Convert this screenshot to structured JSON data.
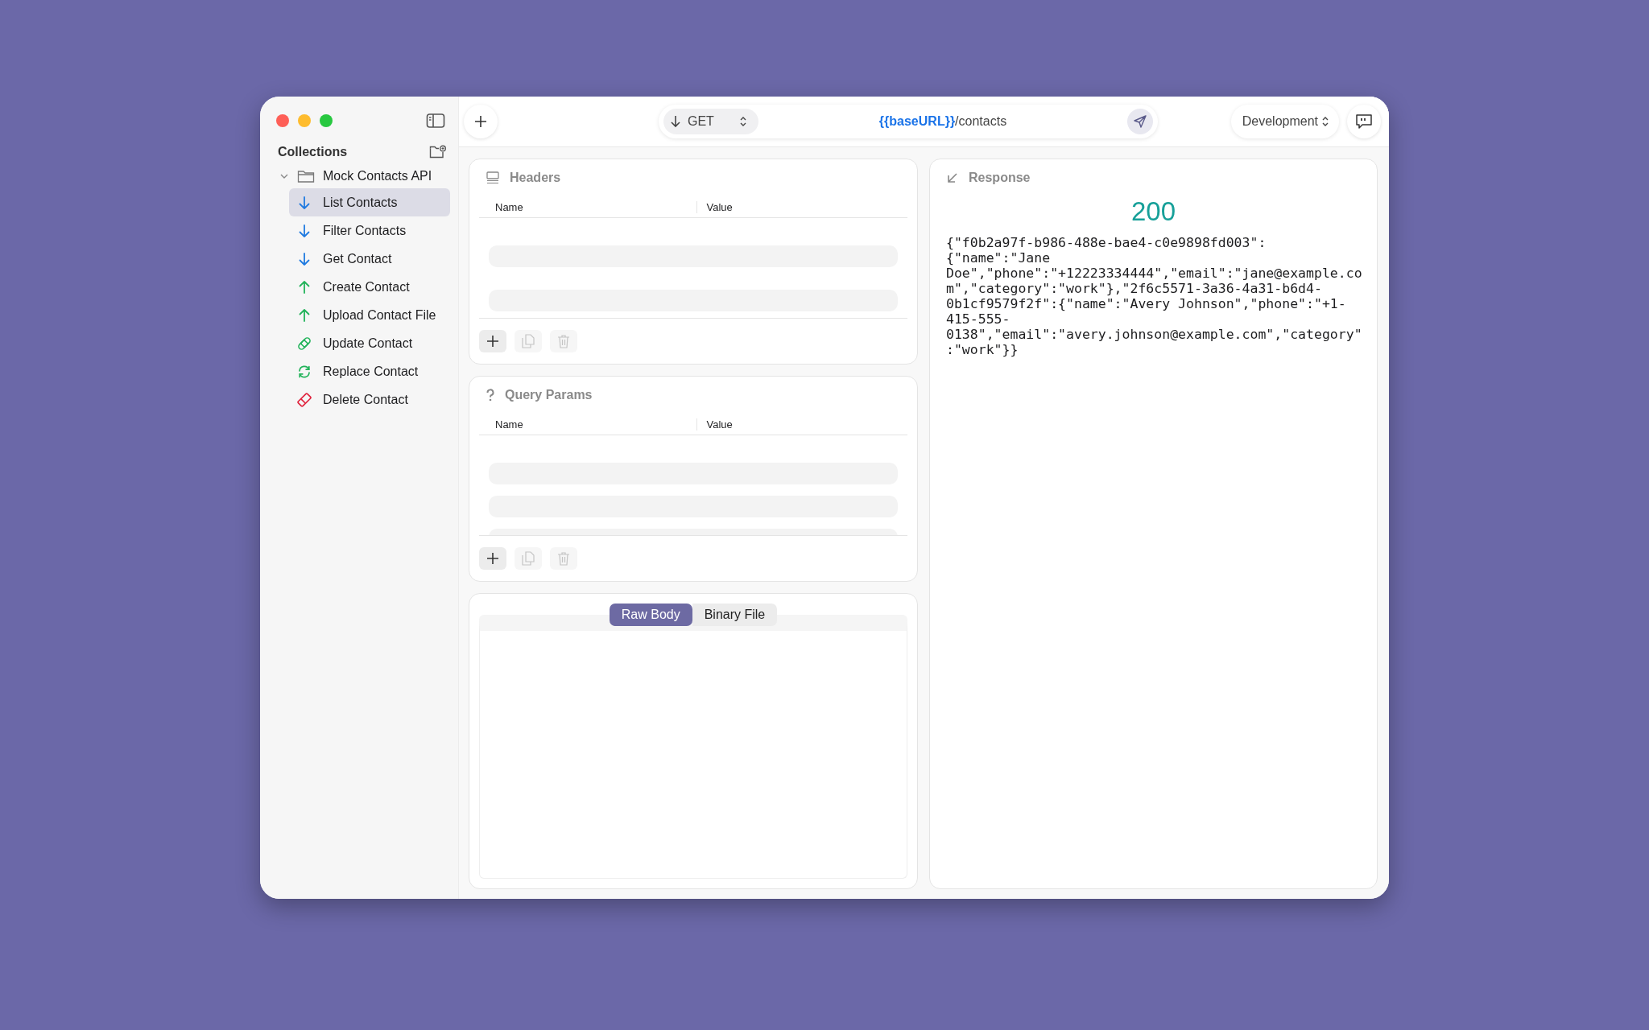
{
  "sidebar": {
    "title": "Collections",
    "collection": {
      "name": "Mock Contacts API",
      "expanded": true,
      "items": [
        {
          "label": "List Contacts",
          "kind": "get",
          "selected": true
        },
        {
          "label": "Filter Contacts",
          "kind": "get",
          "selected": false
        },
        {
          "label": "Get Contact",
          "kind": "get",
          "selected": false
        },
        {
          "label": "Create Contact",
          "kind": "post",
          "selected": false
        },
        {
          "label": "Upload Contact File",
          "kind": "post",
          "selected": false
        },
        {
          "label": "Update Contact",
          "kind": "patch",
          "selected": false
        },
        {
          "label": "Replace Contact",
          "kind": "put",
          "selected": false
        },
        {
          "label": "Delete Contact",
          "kind": "delete",
          "selected": false
        }
      ]
    }
  },
  "toolbar": {
    "method": "GET",
    "url": {
      "variable": "{{baseURL}}",
      "path": "/contacts"
    },
    "environment": "Development"
  },
  "panels": [
    {
      "kind": "headers",
      "title": "Headers",
      "columns": [
        "Name",
        "Value"
      ],
      "buttons": [
        {
          "kind": "add",
          "disabled": false
        },
        {
          "kind": "copy",
          "disabled": true
        },
        {
          "kind": "delete",
          "disabled": true
        }
      ]
    },
    {
      "kind": "query",
      "title": "Query Params",
      "columns": [
        "Name",
        "Value"
      ],
      "buttons": [
        {
          "kind": "add",
          "disabled": false
        },
        {
          "kind": "copy",
          "disabled": true
        },
        {
          "kind": "delete",
          "disabled": true
        }
      ]
    }
  ],
  "body": {
    "tabs": [
      {
        "label": "Raw Body",
        "selected": true
      },
      {
        "label": "Binary File",
        "selected": false
      }
    ]
  },
  "response": {
    "title": "Response",
    "status": "200",
    "body": "{\"f0b2a97f-b986-488e-bae4-c0e9898fd003\":{\"name\":\"Jane Doe\",\"phone\":\"+12223334444\",\"email\":\"jane@example.com\",\"category\":\"work\"},\"2f6c5571-3a36-4a31-b6d4-0b1cf9579f2f\":{\"name\":\"Avery Johnson\",\"phone\":\"+1-415-555-0138\",\"email\":\"avery.johnson@example.com\",\"category\":\"work\"}}"
  }
}
